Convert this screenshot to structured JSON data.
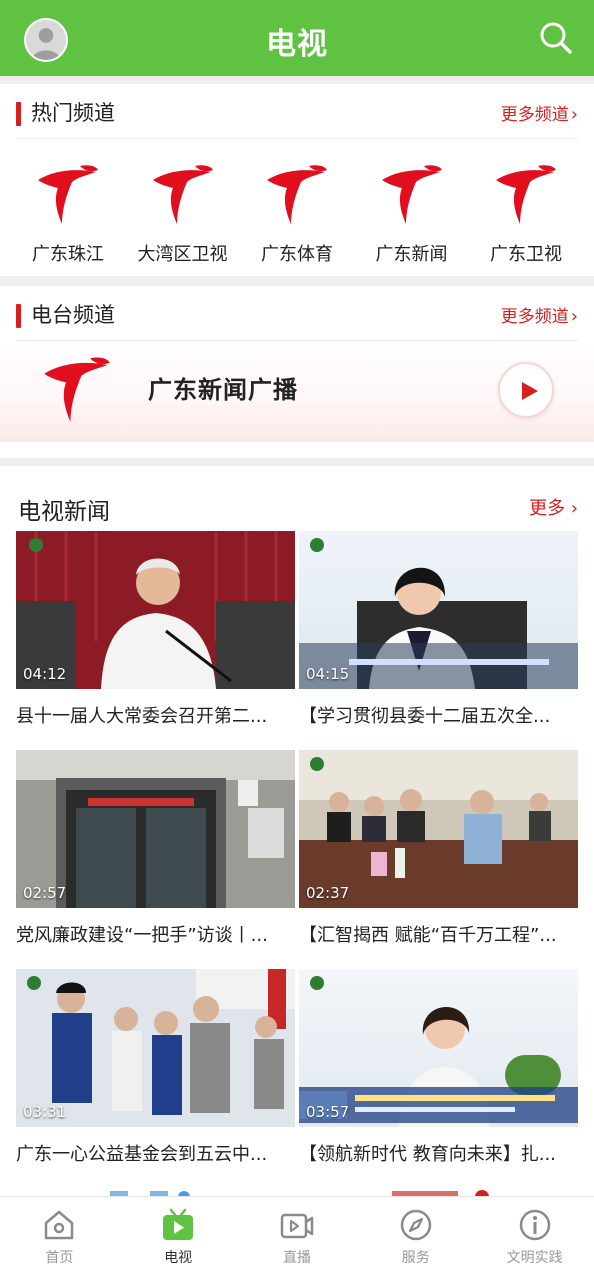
{
  "header": {
    "title": "电视",
    "avatar_icon": "avatar-icon",
    "search_icon": "search-icon"
  },
  "hot_channels": {
    "title": "热门频道",
    "more": "更多频道",
    "items": [
      {
        "label": "广东珠江"
      },
      {
        "label": "大湾区卫视"
      },
      {
        "label": "广东体育"
      },
      {
        "label": "广东新闻"
      },
      {
        "label": "广东卫视"
      }
    ]
  },
  "radio": {
    "title": "电台频道",
    "more": "更多频道",
    "station": "广东新闻广播",
    "play_icon": "play-icon"
  },
  "news": {
    "title": "电视新闻",
    "more": "更多",
    "items": [
      {
        "duration": "04:12",
        "caption": "县十一届人大常委会召开第二..."
      },
      {
        "duration": "04:15",
        "caption": "【学习贯彻县委十二届五次全..."
      },
      {
        "duration": "02:57",
        "caption": "党风廉政建设“一把手”访谈丨..."
      },
      {
        "duration": "02:37",
        "caption": "【汇智揭西 赋能“百千万工程”..."
      },
      {
        "duration": "03:31",
        "caption": "广东一心公益基金会到五云中..."
      },
      {
        "duration": "03:57",
        "caption": "【领航新时代 教育向未来】扎..."
      }
    ]
  },
  "tabs": [
    {
      "label": "首页",
      "icon": "home-icon"
    },
    {
      "label": "电视",
      "icon": "tv-icon"
    },
    {
      "label": "直播",
      "icon": "live-icon"
    },
    {
      "label": "服务",
      "icon": "compass-icon"
    },
    {
      "label": "文明实践",
      "icon": "info-icon"
    }
  ],
  "colors": {
    "brand_green": "#5fc241",
    "accent_red": "#d71f1f"
  }
}
